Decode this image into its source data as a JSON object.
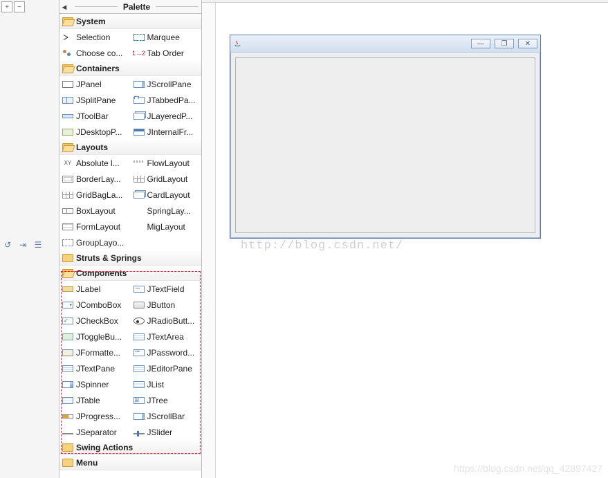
{
  "palette": {
    "title": "Palette",
    "categories": [
      {
        "key": "system",
        "label": "System",
        "open": true,
        "items": [
          {
            "label": "Selection",
            "icon": "cursor"
          },
          {
            "label": "Marquee",
            "icon": "marquee"
          },
          {
            "label": "Choose co...",
            "icon": "balls"
          },
          {
            "label": "Tab Order",
            "icon": "tab12"
          }
        ]
      },
      {
        "key": "containers",
        "label": "Containers",
        "open": true,
        "items": [
          {
            "label": "JPanel",
            "icon": "panel"
          },
          {
            "label": "JScrollPane",
            "icon": "scroll"
          },
          {
            "label": "JSplitPane",
            "icon": "split"
          },
          {
            "label": "JTabbedPa...",
            "icon": "tabs"
          },
          {
            "label": "JToolBar",
            "icon": "toolbar"
          },
          {
            "label": "JLayeredP...",
            "icon": "layer"
          },
          {
            "label": "JDesktopP...",
            "icon": "desk"
          },
          {
            "label": "JInternalFr...",
            "icon": "intf"
          }
        ]
      },
      {
        "key": "layouts",
        "label": "Layouts",
        "open": true,
        "items": [
          {
            "label": "Absolute l...",
            "icon": "xy"
          },
          {
            "label": "FlowLayout",
            "icon": "flow"
          },
          {
            "label": "BorderLay...",
            "icon": "border"
          },
          {
            "label": "GridLayout",
            "icon": "grid"
          },
          {
            "label": "GridBagLa...",
            "icon": "grid"
          },
          {
            "label": "CardLayout",
            "icon": "layer"
          },
          {
            "label": "BoxLayout",
            "icon": "box"
          },
          {
            "label": "SpringLay...",
            "icon": "spring"
          },
          {
            "label": "FormLayout",
            "icon": "form"
          },
          {
            "label": "MigLayout",
            "icon": "mig"
          },
          {
            "label": "GroupLayo...",
            "icon": "group"
          }
        ]
      },
      {
        "key": "struts",
        "label": "Struts & Springs",
        "open": false,
        "items": []
      },
      {
        "key": "components",
        "label": "Components",
        "open": true,
        "highlight": true,
        "items": [
          {
            "label": "JLabel",
            "icon": "label"
          },
          {
            "label": "JTextField",
            "icon": "text"
          },
          {
            "label": "JComboBox",
            "icon": "combo"
          },
          {
            "label": "JButton",
            "icon": "button"
          },
          {
            "label": "JCheckBox",
            "icon": "check"
          },
          {
            "label": "JRadioButt...",
            "icon": "radio"
          },
          {
            "label": "JToggleBu...",
            "icon": "toggle"
          },
          {
            "label": "JTextArea",
            "icon": "area"
          },
          {
            "label": "JFormatte...",
            "icon": "fmt"
          },
          {
            "label": "JPassword...",
            "icon": "pass"
          },
          {
            "label": "JTextPane",
            "icon": "area"
          },
          {
            "label": "JEditorPane",
            "icon": "area"
          },
          {
            "label": "JSpinner",
            "icon": "spinner"
          },
          {
            "label": "JList",
            "icon": "list"
          },
          {
            "label": "JTable",
            "icon": "table"
          },
          {
            "label": "JTree",
            "icon": "tree"
          },
          {
            "label": "JProgress...",
            "icon": "prog"
          },
          {
            "label": "JScrollBar",
            "icon": "scroll"
          },
          {
            "label": "JSeparator",
            "icon": "sep"
          },
          {
            "label": "JSlider",
            "icon": "slider"
          }
        ]
      },
      {
        "key": "swing_actions",
        "label": "Swing Actions",
        "open": false,
        "items": []
      },
      {
        "key": "menu",
        "label": "Menu",
        "open": false,
        "items": []
      }
    ]
  },
  "designer": {
    "frame": {
      "title": "",
      "buttons": {
        "min": "—",
        "max": "❐",
        "close": "✕"
      }
    }
  },
  "tab12": "1→2",
  "watermark": "http://blog.csdn.net/",
  "watermark2": "https://blog.csdn.net/qq_42897427"
}
